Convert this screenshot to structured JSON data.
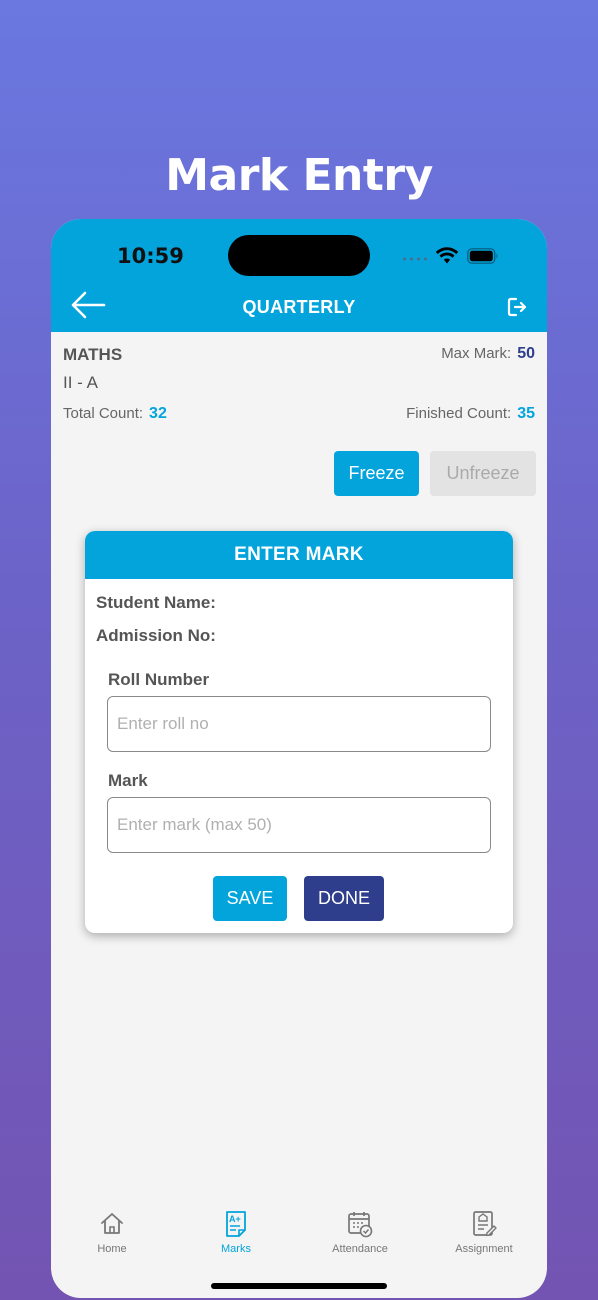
{
  "promo": {
    "title": "Mark Entry"
  },
  "status_bar": {
    "time": "10:59"
  },
  "header": {
    "title": "QUARTERLY"
  },
  "summary": {
    "subject": "MATHS",
    "class": "II - A",
    "max_mark_label": "Max Mark:",
    "max_mark_value": "50",
    "total_count_label": "Total Count:",
    "total_count_value": "32",
    "finished_count_label": "Finished Count:",
    "finished_count_value": "35"
  },
  "actions": {
    "freeze": "Freeze",
    "unfreeze": "Unfreeze"
  },
  "dialog": {
    "title": "ENTER MARK",
    "student_name_label": "Student Name:",
    "admission_no_label": "Admission No:",
    "roll_number_label": "Roll Number",
    "roll_number_value": "",
    "roll_number_placeholder": "Enter roll no",
    "mark_label": "Mark",
    "mark_value": "",
    "mark_placeholder": "Enter mark (max 50)",
    "save": "SAVE",
    "done": "DONE"
  },
  "tabbar": {
    "items": [
      {
        "label": "Home",
        "icon": "home-icon"
      },
      {
        "label": "Marks",
        "icon": "marks-icon"
      },
      {
        "label": "Attendance",
        "icon": "attendance-icon"
      },
      {
        "label": "Assignment",
        "icon": "assignment-icon"
      }
    ],
    "active": "Marks"
  },
  "colors": {
    "primary": "#03a4dc",
    "accent_dark": "#2e3e8c",
    "background": "#f4f4f4",
    "promo_gradient_top": "#6a78e0",
    "promo_gradient_bottom": "#7354b2"
  }
}
